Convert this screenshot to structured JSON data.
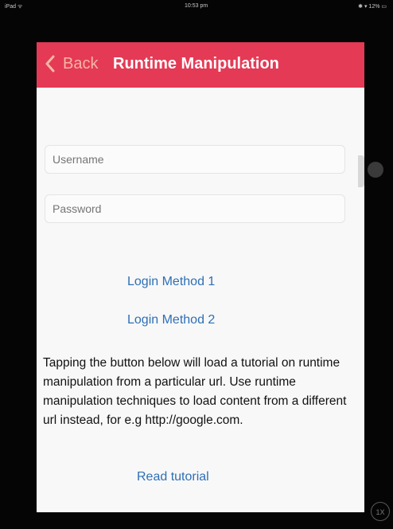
{
  "status_bar": {
    "carrier": "iPad ᯤ",
    "time": "10:53 pm",
    "battery": "✱ ▾ 12% ▭"
  },
  "nav": {
    "back_label": "Back",
    "title": "Runtime Manipulation",
    "bar_color": "#e43a55"
  },
  "form": {
    "username_placeholder": "Username",
    "password_placeholder": "Password"
  },
  "buttons": {
    "login_method_1": "Login Method 1",
    "login_method_2": "Login Method 2",
    "read_tutorial": "Read tutorial",
    "link_color": "#2e6fb6"
  },
  "description": "Tapping the button below will load a tutorial on runtime manipulation from a particular url. Use runtime manipulation techniques to load content from a different url instead, for e.g http://google.com.",
  "zoom_badge": "1X",
  "icons": [
    "back-chevron-icon",
    "wifi-icon",
    "bluetooth-icon",
    "battery-icon"
  ]
}
